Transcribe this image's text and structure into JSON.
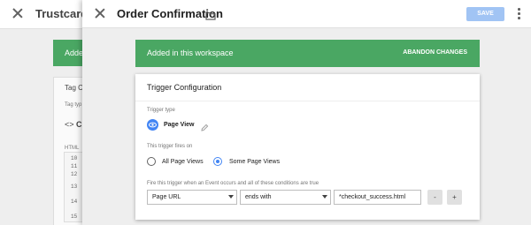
{
  "background": {
    "title": "Trustcard",
    "banner": "Added",
    "tag_config": "Tag Co",
    "tag_type": "Tag typ",
    "code_symbol": "<>",
    "code_letter": "C",
    "html_label": "HTML",
    "line_numbers": [
      "10",
      "11",
      "12",
      "13",
      "14",
      "15"
    ]
  },
  "header": {
    "title": "Order Confirmation",
    "save_label": "SAVE"
  },
  "banner": {
    "message": "Added in this workspace",
    "abandon_label": "ABANDON CHANGES"
  },
  "trigger": {
    "heading": "Trigger Configuration",
    "type_label": "Trigger type",
    "type_value": "Page View",
    "fires_on_label": "This trigger fires on",
    "options": [
      "All Page Views",
      "Some Page Views"
    ],
    "selected_option": "Some Page Views",
    "condition_label": "Fire this trigger when an Event occurs and all of these conditions are true",
    "condition": {
      "variable": "Page URL",
      "operator": "ends with",
      "value": "*checkout_success.html"
    },
    "remove_label": "-",
    "add_label": "+"
  },
  "colors": {
    "accent": "#4285f4",
    "banner": "#4aa763",
    "save_disabled": "#a1c4f4"
  }
}
